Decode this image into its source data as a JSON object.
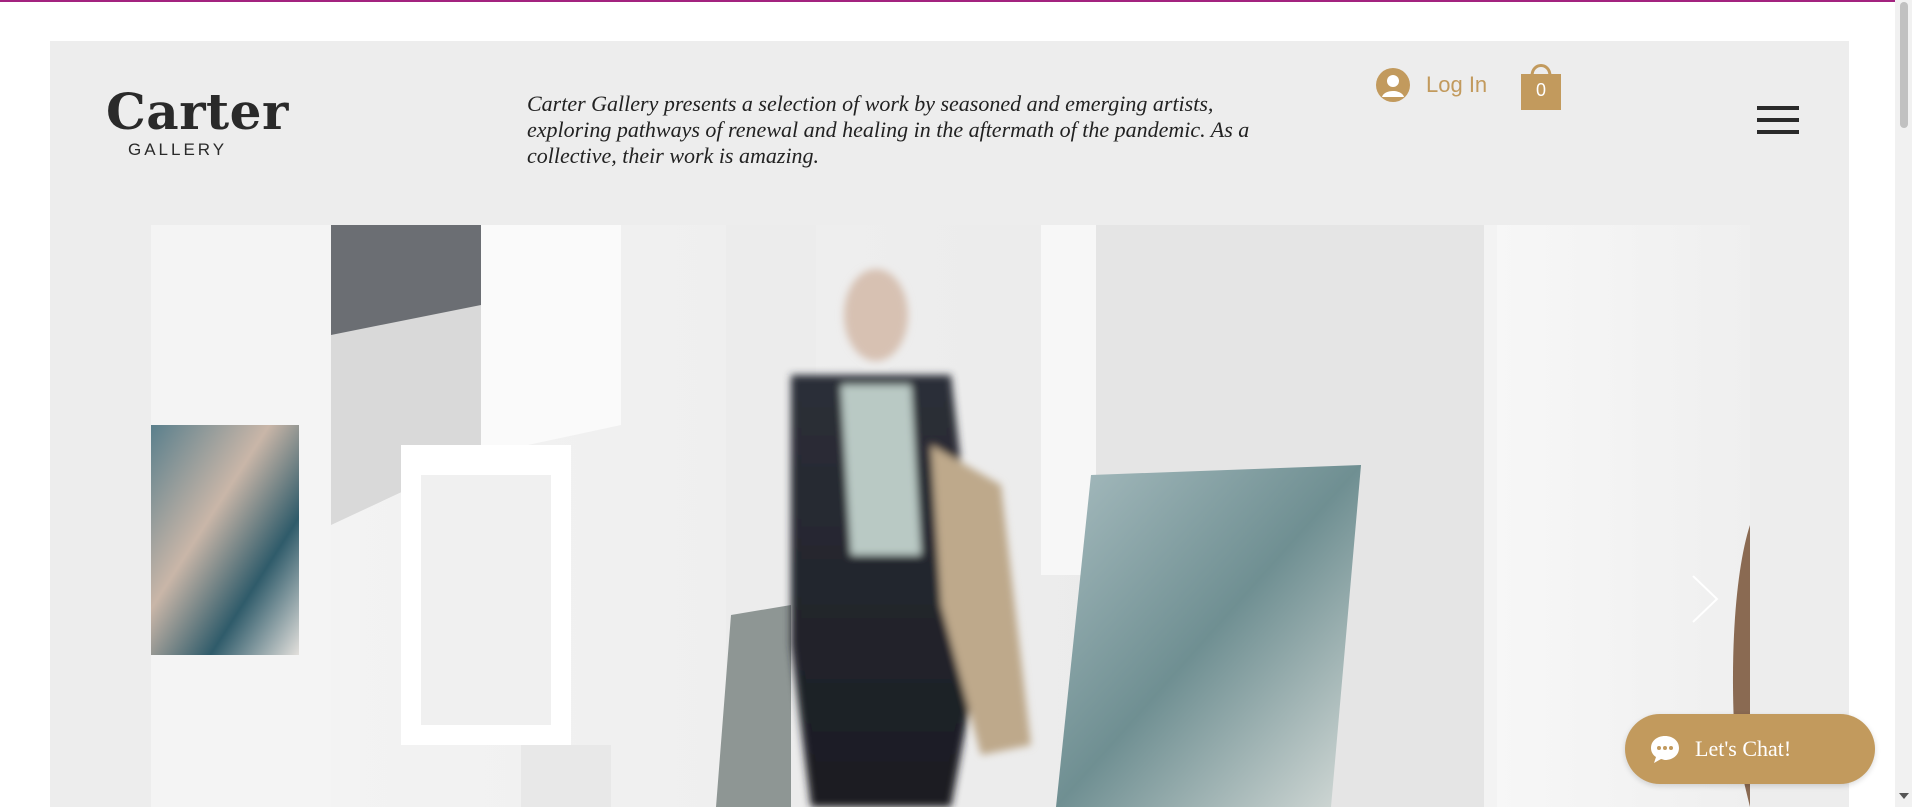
{
  "colors": {
    "accent": "#c29a5d",
    "panel_bg": "#ededed",
    "top_line": "#a3237f",
    "text_dark": "#2a2a2a"
  },
  "header": {
    "logo_main": "Carter",
    "logo_sub": "GALLERY",
    "intro_text": "Carter Gallery presents a selection of work by seasoned and emerging artists, exploring pathways of renewal and healing in the aftermath of the pandemic. As a collective, their work is amazing.",
    "login_label": "Log In",
    "login_icon": "user-avatar-icon",
    "cart_count": "0",
    "cart_icon": "shopping-bag-icon",
    "menu_icon": "hamburger-menu-icon"
  },
  "slider": {
    "next_icon": "chevron-right-icon"
  },
  "chat": {
    "label": "Let's Chat!",
    "icon": "chat-bubble-icon"
  }
}
